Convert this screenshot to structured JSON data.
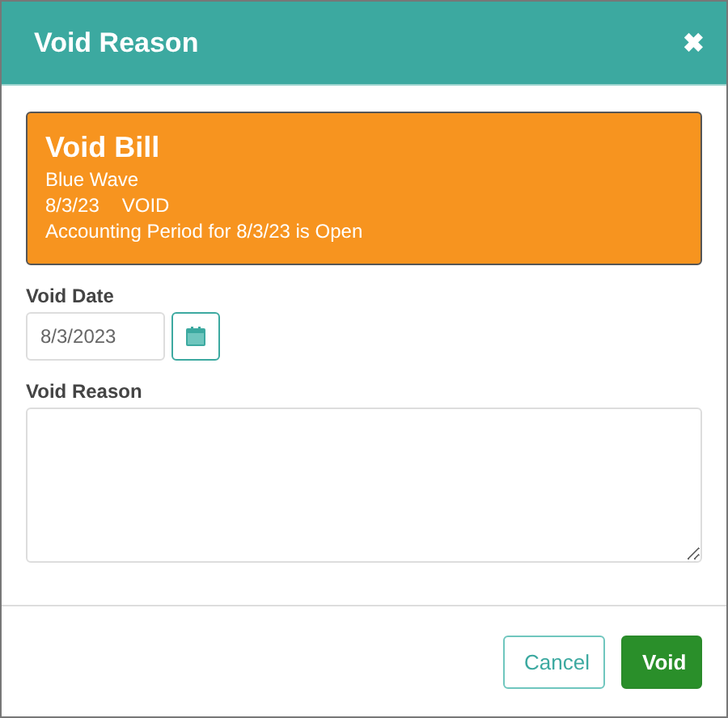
{
  "dialog": {
    "title": "Void Reason",
    "close": "✖"
  },
  "banner": {
    "heading": "Void Bill",
    "vendor": "Blue Wave",
    "date": "8/3/23",
    "status": "VOID",
    "period_note": "Accounting Period for 8/3/23 is Open"
  },
  "void_date": {
    "label": "Void Date",
    "value": "8/3/2023"
  },
  "void_reason": {
    "label": "Void Reason"
  },
  "buttons": [
    {
      "label": "Cancel",
      "kind": "secondary"
    },
    {
      "label": "Void",
      "kind": "primary"
    }
  ]
}
